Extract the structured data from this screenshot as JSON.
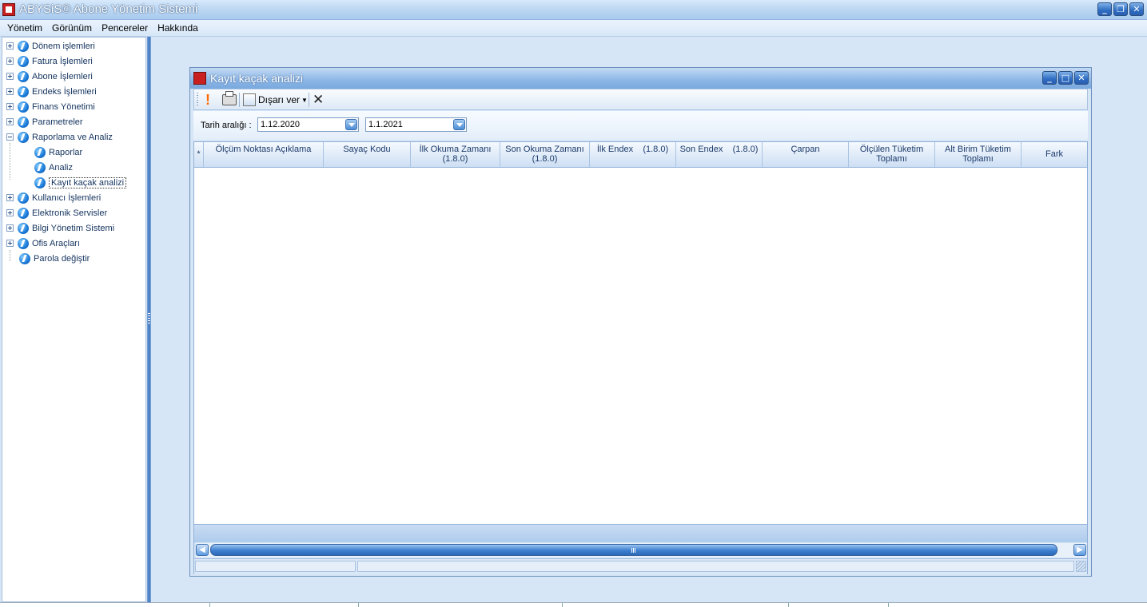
{
  "app": {
    "title": "ABYSiS© Abone Yönetim Sistemi",
    "window_buttons": {
      "minimize": "_",
      "restore": "❐",
      "close": "✕"
    }
  },
  "menu": [
    "Yönetim",
    "Görünüm",
    "Pencereler",
    "Hakkında"
  ],
  "nav": {
    "items": [
      {
        "label": "Dönem işlemleri",
        "expander": "collapsed"
      },
      {
        "label": "Fatura İşlemleri",
        "expander": "collapsed"
      },
      {
        "label": "Abone İşlemleri",
        "expander": "collapsed"
      },
      {
        "label": "Endeks İşlemleri",
        "expander": "collapsed"
      },
      {
        "label": "Finans Yönetimi",
        "expander": "collapsed"
      },
      {
        "label": "Parametreler",
        "expander": "collapsed"
      },
      {
        "label": "Raporlama ve Analiz",
        "expander": "expanded"
      },
      {
        "label": "Raporlar",
        "child": true
      },
      {
        "label": "Analiz",
        "child": true
      },
      {
        "label": "Kayıt kaçak analizi",
        "child": true,
        "selected": true
      },
      {
        "label": "Kullanıcı İşlemleri",
        "expander": "collapsed"
      },
      {
        "label": "Elektronik Servisler",
        "expander": "collapsed"
      },
      {
        "label": "Bilgi Yönetim Sistemi",
        "expander": "collapsed"
      },
      {
        "label": "Ofis Araçları",
        "expander": "collapsed"
      },
      {
        "label": "Parola değiştir",
        "expander": "none"
      }
    ]
  },
  "child_window": {
    "title": "Kayıt kaçak analizi",
    "toolbar": {
      "run_icon": "!",
      "export_label": "Dışarı ver",
      "close_icon": "✕"
    },
    "filter": {
      "date_range_label": "Tarih aralığı :",
      "start_date": "1.12.2020",
      "end_date": "1.1.2021"
    },
    "grid": {
      "indicator": "*",
      "columns": [
        "Ölçüm Noktası Açıklama",
        "Sayaç Kodu",
        "İlk Okuma Zamanı\n(1.8.0)",
        "Son Okuma Zamanı\n(1.8.0)",
        "İlk Endex    (1.8.0)",
        "Son Endex    (1.8.0)",
        "Çarpan",
        "Ölçülen Tüketim\nToplamı",
        "Alt Birim Tüketim\nToplamı",
        "Fark"
      ],
      "rows": []
    }
  },
  "colors": {
    "accent": "#2e6cc2",
    "background": "#d6e6f6",
    "run_icon": "#ff6a00"
  }
}
